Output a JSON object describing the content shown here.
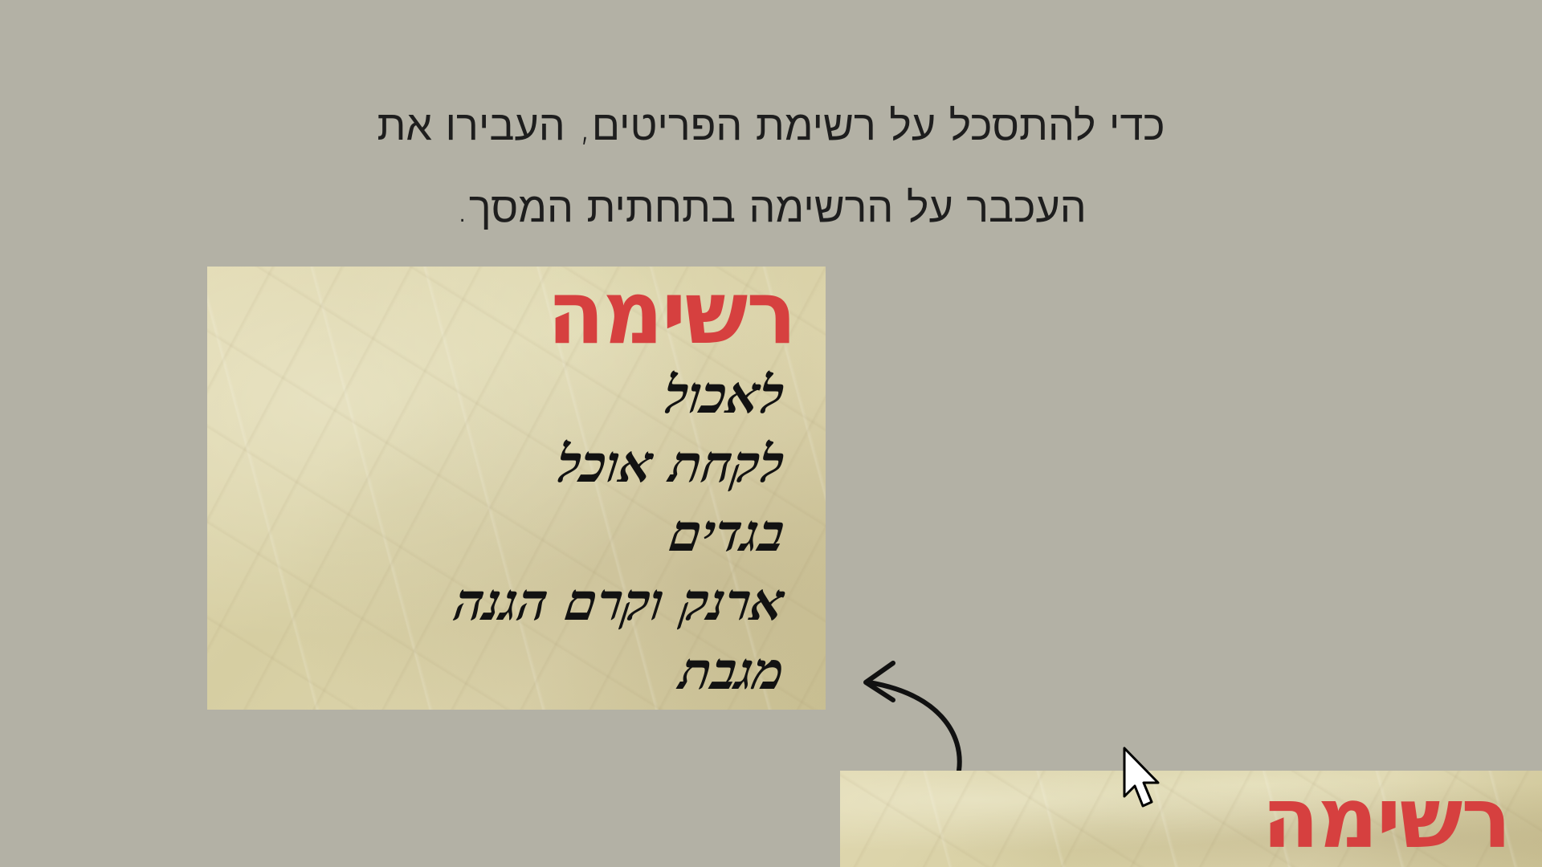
{
  "instruction": {
    "line1": "כדי להתסכל על רשימת הפריטים, העבירו את",
    "line2": "העכבר על הרשימה בתחתית המסך."
  },
  "list_panel": {
    "title": "רשימה",
    "items": [
      "לאכול",
      "לקחת אוכל",
      "בגדים",
      "ארנק וקרם הגנה",
      "מגבת"
    ]
  },
  "collapsed_tab": {
    "title": "רשימה"
  },
  "colors": {
    "background": "#b3b1a5",
    "title_red": "#d6403f",
    "text_dark": "#1e1e1e",
    "paper": "#d9d1a8"
  },
  "icons": {
    "arrow": "curved-arrow-icon",
    "cursor": "mouse-pointer-icon"
  }
}
